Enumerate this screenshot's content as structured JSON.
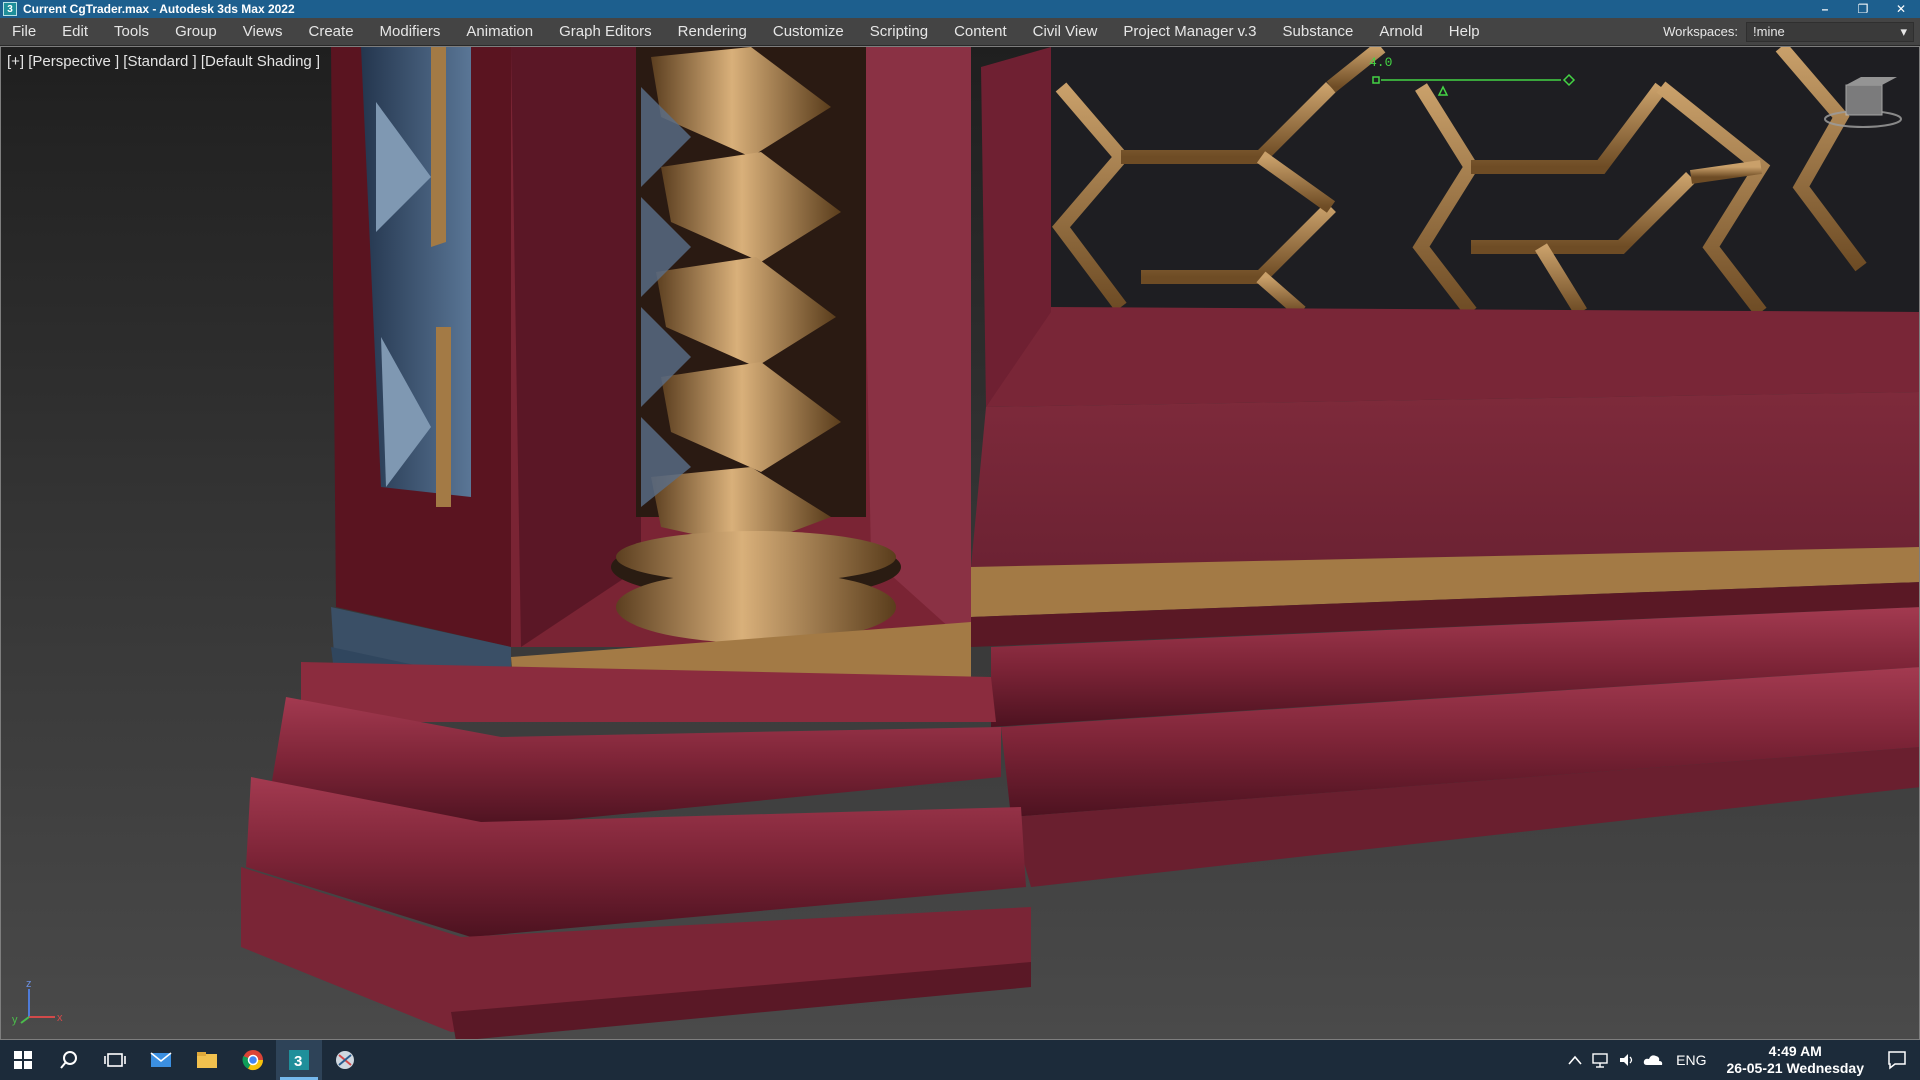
{
  "window": {
    "title": "Current CgTrader.max - Autodesk 3ds Max 2022",
    "app_icon_glyph": "3",
    "controls": {
      "minimize": "–",
      "restore": "❐",
      "close": "✕"
    }
  },
  "menubar": {
    "items": [
      "File",
      "Edit",
      "Tools",
      "Group",
      "Views",
      "Create",
      "Modifiers",
      "Animation",
      "Graph Editors",
      "Rendering",
      "Customize",
      "Scripting",
      "Content",
      "Civil View",
      "Project Manager v.3",
      "Substance",
      "Arnold",
      "Help"
    ],
    "workspaces_label": "Workspaces:",
    "workspaces_value": "!mine",
    "workspaces_arrow": "▾"
  },
  "viewport": {
    "label": "[+] [Perspective ] [Standard ] [Default Shading ]",
    "hud_value": "4.0",
    "axis": {
      "x": "x",
      "y": "y",
      "z": "z"
    },
    "colors": {
      "maroon": "#7e2a3b",
      "gold": "#a37a45",
      "blue": "#3c5a7a"
    }
  },
  "taskbar": {
    "icons": [
      "windows-start",
      "search",
      "task-view",
      "mail",
      "file-explorer",
      "chrome",
      "3ds-max",
      "snipping-tool"
    ],
    "active_icon": "3ds-max",
    "language": "ENG",
    "time": "4:49 AM",
    "date": "26-05-21 Wednesday",
    "accent": "#76b9ed"
  }
}
